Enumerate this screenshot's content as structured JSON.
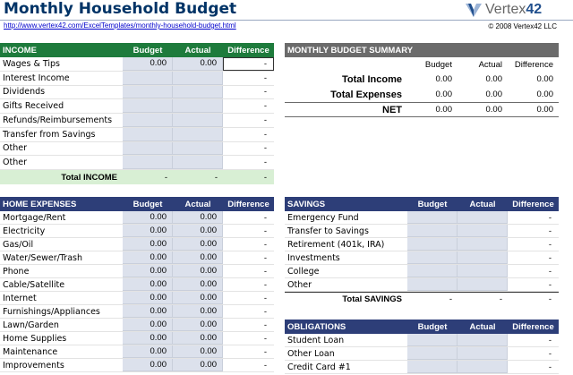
{
  "header": {
    "title": "Monthly Household Budget",
    "url": "http://www.vertex42.com/ExcelTemplates/monthly-household-budget.html",
    "logo_light": "Vertex",
    "logo_bold": "42",
    "copyright": "© 2008 Vertex42 LLC"
  },
  "income": {
    "title": "INCOME",
    "col_budget": "Budget",
    "col_actual": "Actual",
    "col_difference": "Difference",
    "rows": [
      {
        "label": "Wages & Tips",
        "budget": "0.00",
        "actual": "0.00",
        "difference": "-"
      },
      {
        "label": "Interest Income",
        "budget": "",
        "actual": "",
        "difference": "-"
      },
      {
        "label": "Dividends",
        "budget": "",
        "actual": "",
        "difference": "-"
      },
      {
        "label": "Gifts Received",
        "budget": "",
        "actual": "",
        "difference": "-"
      },
      {
        "label": "Refunds/Reimbursements",
        "budget": "",
        "actual": "",
        "difference": "-"
      },
      {
        "label": "Transfer from Savings",
        "budget": "",
        "actual": "",
        "difference": "-"
      },
      {
        "label": "Other",
        "budget": "",
        "actual": "",
        "difference": "-"
      },
      {
        "label": "Other",
        "budget": "",
        "actual": "",
        "difference": "-"
      }
    ],
    "total_label": "Total INCOME",
    "total_budget": "-",
    "total_actual": "-",
    "total_difference": "-"
  },
  "summary": {
    "title": "MONTHLY BUDGET SUMMARY",
    "col_budget": "Budget",
    "col_actual": "Actual",
    "col_difference": "Difference",
    "rows": [
      {
        "label": "Total Income",
        "budget": "0.00",
        "actual": "0.00",
        "difference": "0.00"
      },
      {
        "label": "Total Expenses",
        "budget": "0.00",
        "actual": "0.00",
        "difference": "0.00"
      },
      {
        "label": "NET",
        "budget": "0.00",
        "actual": "0.00",
        "difference": "0.00"
      }
    ]
  },
  "home_expenses": {
    "title": "HOME EXPENSES",
    "col_budget": "Budget",
    "col_actual": "Actual",
    "col_difference": "Difference",
    "rows": [
      {
        "label": "Mortgage/Rent",
        "budget": "0.00",
        "actual": "0.00",
        "difference": "-"
      },
      {
        "label": "Electricity",
        "budget": "0.00",
        "actual": "0.00",
        "difference": "-"
      },
      {
        "label": "Gas/Oil",
        "budget": "0.00",
        "actual": "0.00",
        "difference": "-"
      },
      {
        "label": "Water/Sewer/Trash",
        "budget": "0.00",
        "actual": "0.00",
        "difference": "-"
      },
      {
        "label": "Phone",
        "budget": "0.00",
        "actual": "0.00",
        "difference": "-"
      },
      {
        "label": "Cable/Satellite",
        "budget": "0.00",
        "actual": "0.00",
        "difference": "-"
      },
      {
        "label": "Internet",
        "budget": "0.00",
        "actual": "0.00",
        "difference": "-"
      },
      {
        "label": "Furnishings/Appliances",
        "budget": "0.00",
        "actual": "0.00",
        "difference": "-"
      },
      {
        "label": "Lawn/Garden",
        "budget": "0.00",
        "actual": "0.00",
        "difference": "-"
      },
      {
        "label": "Home Supplies",
        "budget": "0.00",
        "actual": "0.00",
        "difference": "-"
      },
      {
        "label": "Maintenance",
        "budget": "0.00",
        "actual": "0.00",
        "difference": "-"
      },
      {
        "label": "Improvements",
        "budget": "0.00",
        "actual": "0.00",
        "difference": "-"
      }
    ]
  },
  "savings": {
    "title": "SAVINGS",
    "col_budget": "Budget",
    "col_actual": "Actual",
    "col_difference": "Difference",
    "rows": [
      {
        "label": "Emergency Fund",
        "budget": "",
        "actual": "",
        "difference": "-"
      },
      {
        "label": "Transfer to Savings",
        "budget": "",
        "actual": "",
        "difference": "-"
      },
      {
        "label": "Retirement (401k, IRA)",
        "budget": "",
        "actual": "",
        "difference": "-"
      },
      {
        "label": "Investments",
        "budget": "",
        "actual": "",
        "difference": "-"
      },
      {
        "label": "College",
        "budget": "",
        "actual": "",
        "difference": "-"
      },
      {
        "label": "Other",
        "budget": "",
        "actual": "",
        "difference": "-"
      }
    ],
    "total_label": "Total SAVINGS",
    "total_budget": "-",
    "total_actual": "-",
    "total_difference": "-"
  },
  "obligations": {
    "title": "OBLIGATIONS",
    "col_budget": "Budget",
    "col_actual": "Actual",
    "col_difference": "Difference",
    "rows": [
      {
        "label": "Student Loan",
        "budget": "",
        "actual": "",
        "difference": "-"
      },
      {
        "label": "Other Loan",
        "budget": "",
        "actual": "",
        "difference": "-"
      },
      {
        "label": "Credit Card #1",
        "budget": "",
        "actual": "",
        "difference": "-"
      }
    ]
  }
}
